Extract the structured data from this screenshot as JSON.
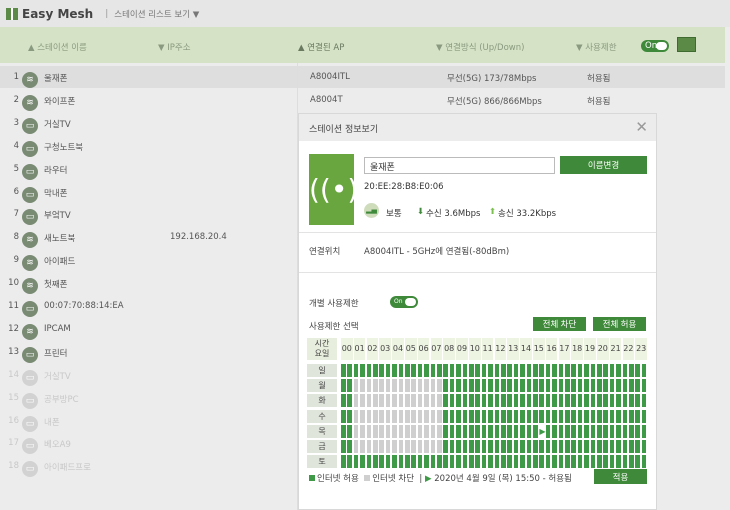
{
  "header": {
    "app_title": "Easy Mesh",
    "view_select": "스테이션 리스트 보기 ▼"
  },
  "columns": {
    "name": "▲ 스테이션 이름",
    "ip": "▼ IP주소",
    "ap": "▲ 연결된 AP",
    "conn": "▼ 연결방식 (Up/Down)",
    "limit": "▼ 사용제한",
    "toggle": "On"
  },
  "stations": [
    {
      "n": "1",
      "icon": "wifi",
      "name": "울재폰",
      "ip": "",
      "ap": "A8004ITL",
      "conn": "무선(5G) 173/78Mbps",
      "limit": "허용됨",
      "active": true,
      "selected": true
    },
    {
      "n": "2",
      "icon": "wifi",
      "name": "와이프폰",
      "ip": "",
      "ap": "A8004T",
      "conn": "무선(5G) 866/866Mbps",
      "limit": "허용됨",
      "active": true
    },
    {
      "n": "3",
      "icon": "pc",
      "name": "거실TV",
      "active": true
    },
    {
      "n": "4",
      "icon": "pc",
      "name": "구청노트북",
      "active": true
    },
    {
      "n": "5",
      "icon": "pc",
      "name": "라우터",
      "active": true
    },
    {
      "n": "6",
      "icon": "pc",
      "name": "막내폰",
      "active": true
    },
    {
      "n": "7",
      "icon": "pc",
      "name": "부엌TV",
      "active": true
    },
    {
      "n": "8",
      "icon": "wifi",
      "name": "새노트북",
      "ip": "192.168.20.4",
      "active": true
    },
    {
      "n": "9",
      "icon": "wifi",
      "name": "아이패드",
      "active": true
    },
    {
      "n": "10",
      "icon": "wifi",
      "name": "첫째폰",
      "active": true
    },
    {
      "n": "11",
      "icon": "pc",
      "name": "00:07:70:88:14:EA",
      "active": true
    },
    {
      "n": "12",
      "icon": "wifi",
      "name": "IPCAM",
      "active": true
    },
    {
      "n": "13",
      "icon": "pc",
      "name": "프린터",
      "active": true
    },
    {
      "n": "14",
      "icon": "pc",
      "name": "거실TV",
      "active": false
    },
    {
      "n": "15",
      "icon": "pc",
      "name": "공부방PC",
      "active": false
    },
    {
      "n": "16",
      "icon": "pc",
      "name": "내폰",
      "active": false
    },
    {
      "n": "17",
      "icon": "pc",
      "name": "베오A9",
      "active": false
    },
    {
      "n": "18",
      "icon": "pc",
      "name": "아이패드프로",
      "active": false
    }
  ],
  "modal": {
    "title": "스테이션 정보보기",
    "name_value": "울재폰",
    "rename_label": "이름변경",
    "mac": "20:EE:28:B8:E0:06",
    "signal": "보통",
    "rx": "수신 3.6Mbps",
    "tx": "송신 33.2Kbps",
    "location_label": "연결위치",
    "location_value": "A8004ITL - 5GHz에 연결됨(-80dBm)",
    "restrict_label": "개별 사용제한",
    "restrict_toggle": "On",
    "select_label": "사용제한 선택",
    "block_all": "전체 차단",
    "allow_all": "전체 허용",
    "corner_top": "시간",
    "corner_bottom": "요일",
    "hours": [
      "00",
      "01",
      "02",
      "03",
      "04",
      "05",
      "06",
      "07",
      "08",
      "09",
      "10",
      "11",
      "12",
      "13",
      "14",
      "15",
      "16",
      "17",
      "18",
      "19",
      "20",
      "21",
      "22",
      "23"
    ],
    "days": [
      "일",
      "월",
      "화",
      "수",
      "목",
      "금",
      "토"
    ],
    "schedule": [
      "111111111111111111111111111111111111111111111111",
      "110000000000000011111111111111111111111111111111",
      "110000000000000011111111111111111111111111111111",
      "110000000000000011111111111111111111111111111111",
      "110000000000000011111111111111111111111111111111",
      "110000000000000011111111111111111111111111111111",
      "111111111111111111111111111111111111111111111111"
    ],
    "current_slot": {
      "day": 4,
      "slot": 31
    },
    "legend_allow": "인터넷 허용",
    "legend_block": "인터넷 차단",
    "now_status": "2020년 4월 9일 (목) 15:50 - 허용됨",
    "apply": "적용",
    "colors": {
      "allow": "#3f9a47",
      "block": "#cfcfcf",
      "accent": "#3f8a3a"
    }
  }
}
